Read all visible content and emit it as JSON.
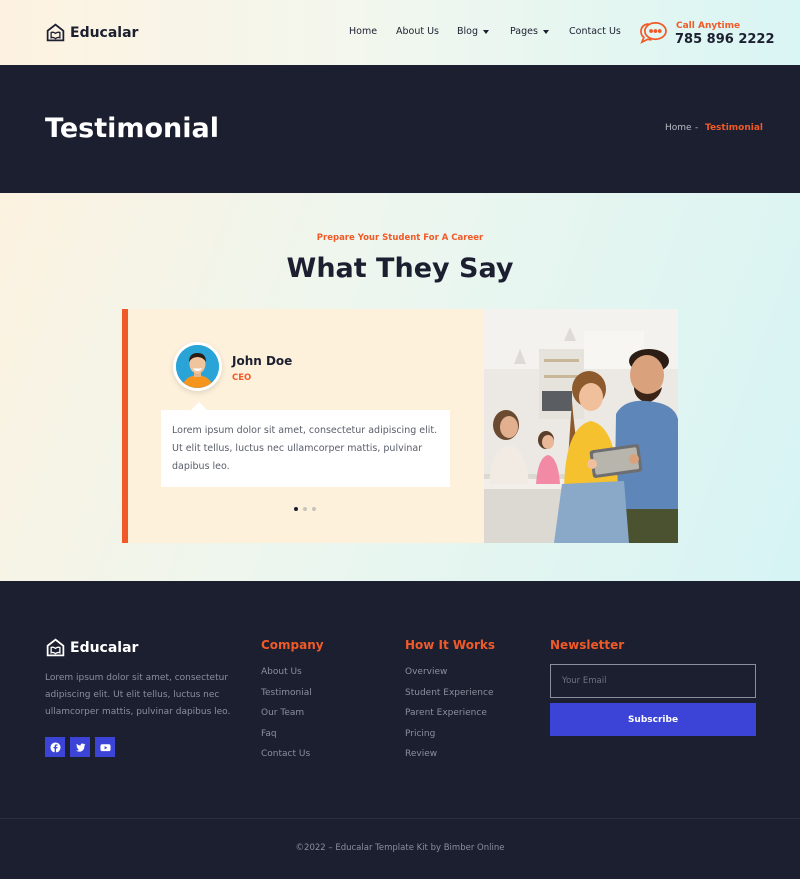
{
  "header": {
    "logo_text": "Educalar",
    "nav": [
      {
        "label": "Home",
        "dropdown": false
      },
      {
        "label": "About Us",
        "dropdown": false
      },
      {
        "label": "Blog",
        "dropdown": true
      },
      {
        "label": "Pages",
        "dropdown": true
      },
      {
        "label": "Contact Us",
        "dropdown": false
      }
    ],
    "call_label": "Call Anytime",
    "call_number": "785 896 2222",
    "call_icon": "chat-bubble-icon"
  },
  "banner": {
    "title": "Testimonial",
    "breadcrumb": {
      "home": "Home",
      "separator": "-",
      "current": "Testimonial"
    }
  },
  "testimonials": {
    "eyebrow": "Prepare Your Student For A Career",
    "title": "What They Say",
    "name": "John Doe",
    "role": "CEO",
    "quote": "Lorem ipsum dolor sit amet, consectetur adipiscing elit. Ut elit tellus, luctus nec ullamcorper mattis, pulvinar dapibus leo.",
    "slide_count": 3,
    "active_slide": 1
  },
  "footer": {
    "logo_text": "Educalar",
    "about": "Lorem ipsum dolor sit amet, consectetur adipiscing elit. Ut elit tellus, luctus nec ullamcorper mattis, pulvinar dapibus leo.",
    "social": [
      "facebook-icon",
      "twitter-icon",
      "youtube-icon"
    ],
    "company": {
      "title": "Company",
      "links": [
        "About Us",
        "Testimonial",
        "Our Team",
        "Faq",
        "Contact Us"
      ]
    },
    "how_it_works": {
      "title": "How It Works",
      "links": [
        "Overview",
        "Student Experience",
        "Parent Experience",
        "Pricing",
        "Review"
      ]
    },
    "newsletter": {
      "title": "Newsletter",
      "placeholder": "Your Email",
      "button": "Subscribe"
    },
    "copyright": "©2022 – Educalar Template Kit by Bimber Online"
  },
  "colors": {
    "accent": "#f05a28",
    "dark": "#1c1f30",
    "button_blue": "#3b44d6"
  }
}
